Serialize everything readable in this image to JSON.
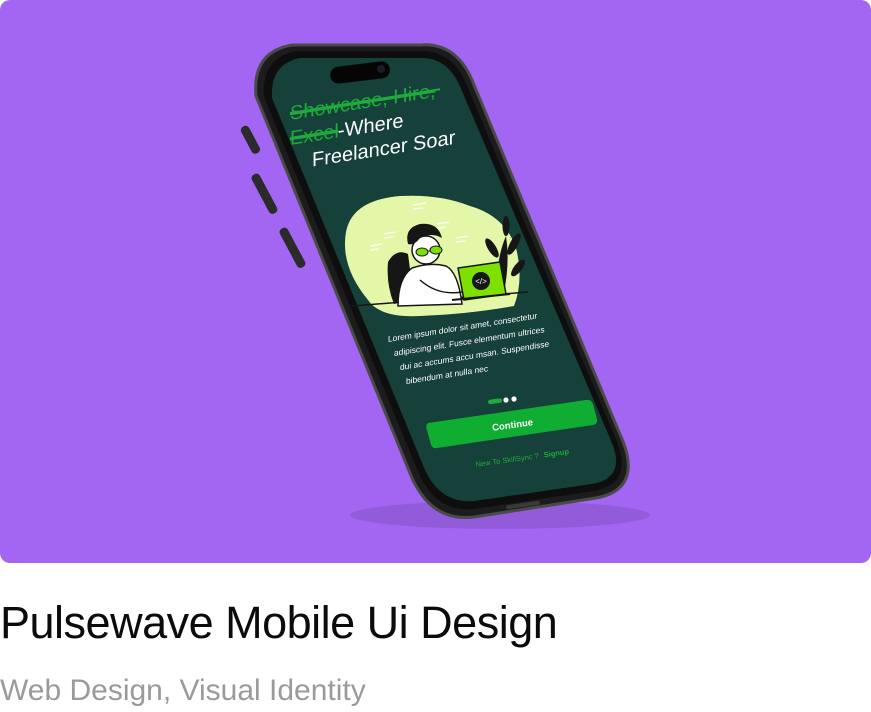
{
  "colors": {
    "hero_background": "#a366f3",
    "screen_background": "#16403a",
    "accent_green": "#1eaa3c",
    "lime": "#e4f7a9",
    "title_text": "#0b0b0b",
    "tags_text": "#9a9a9a"
  },
  "mockup": {
    "headline_struck_1": "Showcase, Hire,",
    "headline_struck_2": "Excel",
    "headline_rest": "-Where",
    "headline_line_3": "Freelancer Soar",
    "body_lines": [
      "Lorem ipsum dolor sit amet, consectetur",
      "adipiscing elit. Fusce elementum ultrices",
      "dui ac accums accu msan. Suspendisse",
      "bibendum at nulla nec"
    ],
    "continue_label": "Continue",
    "signup_prompt": "New To SkillSync ?",
    "signup_link": "Signup",
    "laptop_code_label": "</>",
    "pager": {
      "count": 3,
      "active": 0
    }
  },
  "project": {
    "title": "Pulsewave Mobile Ui Design",
    "tags": "Web Design, Visual Identity"
  }
}
